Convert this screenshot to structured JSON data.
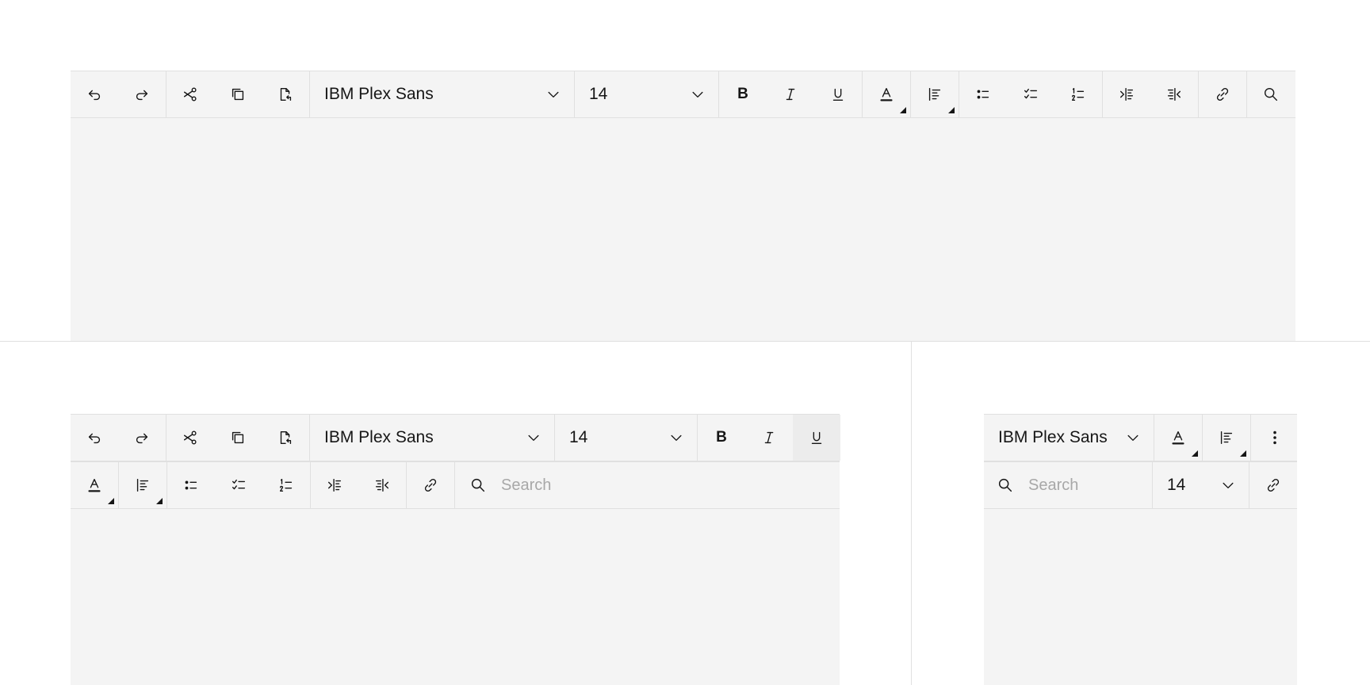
{
  "toolbar_full": {
    "font_family": "IBM Plex Sans",
    "font_size": "14",
    "bold_label": "B"
  },
  "toolbar_medium": {
    "font_family": "IBM Plex Sans",
    "font_size": "14",
    "bold_label": "B",
    "search_placeholder": "Search"
  },
  "toolbar_compact": {
    "font_family": "IBM Plex Sans",
    "font_size": "14",
    "search_placeholder": "Search"
  },
  "icons": [
    "undo-icon",
    "redo-icon",
    "cut-icon",
    "copy-icon",
    "paste-icon",
    "chevron-down-icon",
    "bold-icon",
    "italic-icon",
    "underline-icon",
    "text-color-icon",
    "align-left-icon",
    "bullet-list-icon",
    "checklist-icon",
    "numbered-list-icon",
    "indent-icon",
    "outdent-icon",
    "link-icon",
    "search-icon",
    "overflow-menu-icon"
  ],
  "colors": {
    "toolbar_bg": "#f4f4f4",
    "divider": "#e0e0e0",
    "icon": "#161616",
    "placeholder": "#a8a8a8"
  }
}
